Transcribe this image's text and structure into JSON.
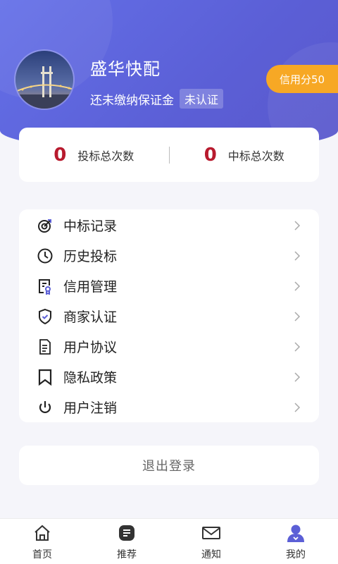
{
  "profile": {
    "name": "盛华快配",
    "deposit_status": "还未缴纳保证金",
    "cert_status": "未认证",
    "credit_label": "信用分50"
  },
  "stats": [
    {
      "value": "0",
      "label": "投标总次数"
    },
    {
      "value": "0",
      "label": "中标总次数"
    }
  ],
  "menu": [
    {
      "label": "中标记录",
      "icon": "target-icon"
    },
    {
      "label": "历史投标",
      "icon": "clock-icon"
    },
    {
      "label": "信用管理",
      "icon": "certificate-icon"
    },
    {
      "label": "商家认证",
      "icon": "shield-check-icon"
    },
    {
      "label": "用户协议",
      "icon": "document-icon"
    },
    {
      "label": "隐私政策",
      "icon": "bookmark-icon"
    },
    {
      "label": "用户注销",
      "icon": "power-icon"
    }
  ],
  "logout_label": "退出登录",
  "tabs": [
    {
      "label": "首页",
      "icon": "home-icon"
    },
    {
      "label": "推荐",
      "icon": "list-icon"
    },
    {
      "label": "通知",
      "icon": "mail-icon"
    },
    {
      "label": "我的",
      "icon": "user-icon",
      "active": true
    }
  ],
  "colors": {
    "header": "#5b5fd6",
    "credit_badge": "#f7a825",
    "stat_number": "#b81a2e",
    "active_tab": "#5b5fd6"
  }
}
